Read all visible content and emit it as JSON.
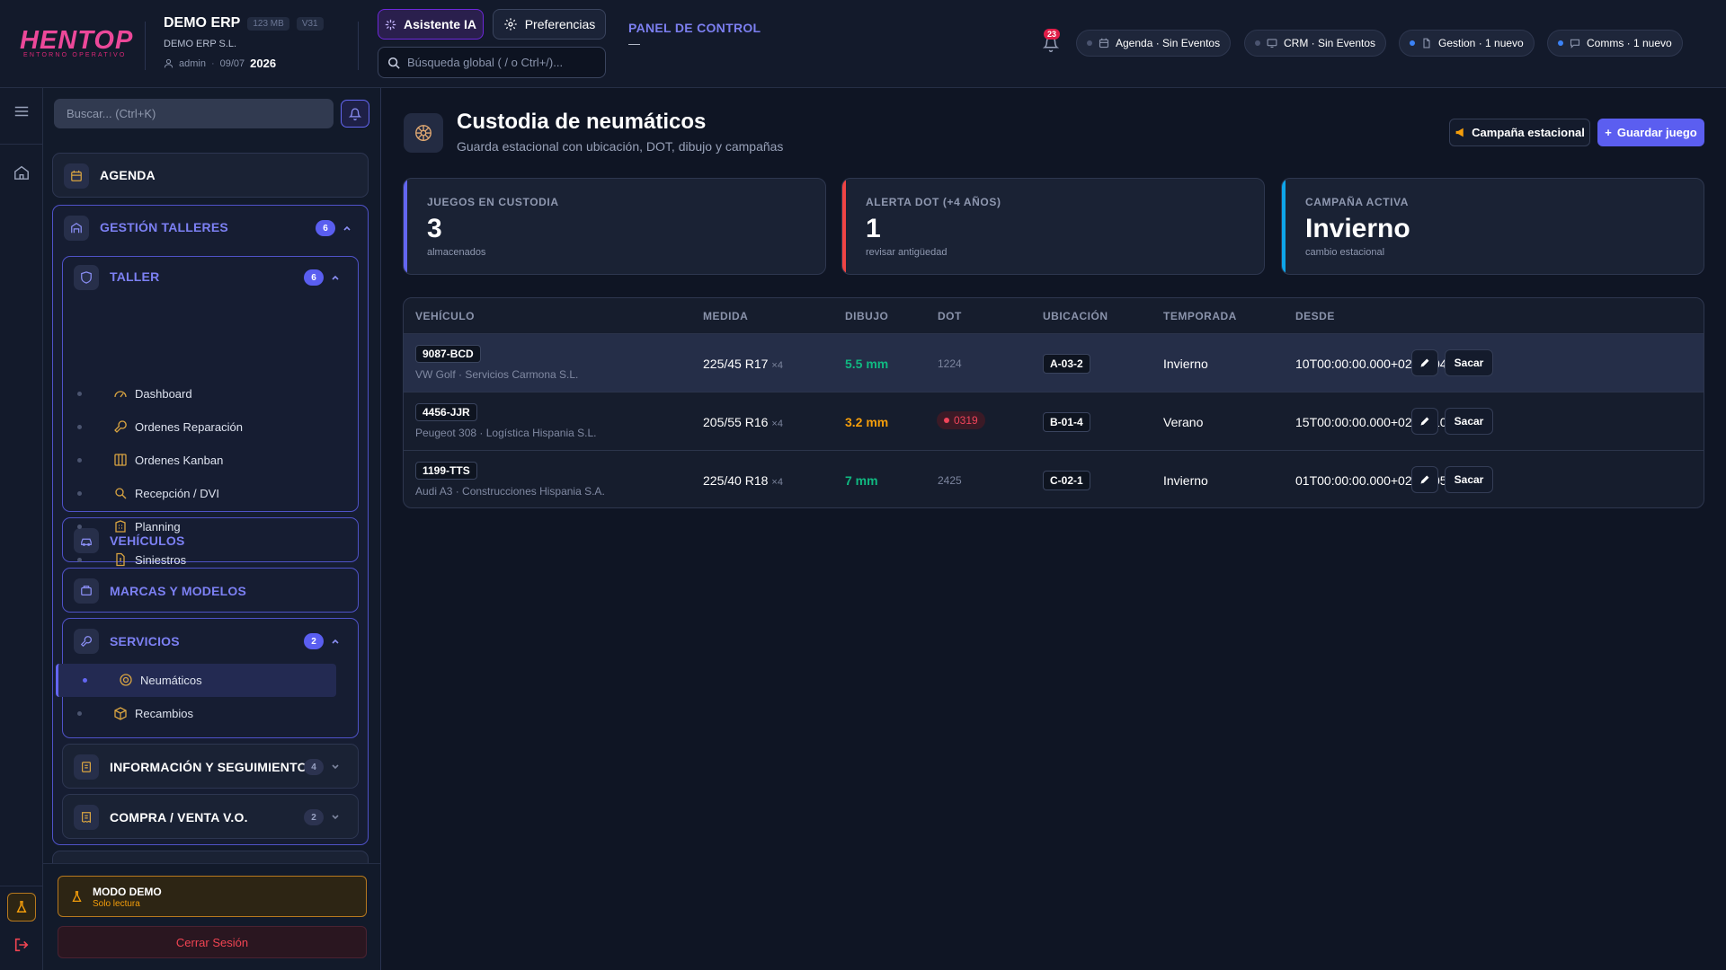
{
  "brand": {
    "logo_text": "HENTOP",
    "logo_sub": "ENTORNO OPERATIVO"
  },
  "erp": {
    "title": "DEMO ERP",
    "mem": "123 MB",
    "version": "V31",
    "company": "DEMO ERP S.L.",
    "user": "admin",
    "date": "09/07",
    "year": "2026"
  },
  "header": {
    "ai_label": "Asistente IA",
    "prefs_label": "Preferencias",
    "search_placeholder": "Búsqueda global ( / o Ctrl+/)...",
    "panel_label": "PANEL DE CONTROL",
    "panel_value": "—",
    "notif_count": "23",
    "pills": [
      {
        "label": "Agenda · Sin Eventos",
        "dot": "#4b5470"
      },
      {
        "label": "CRM · Sin Eventos",
        "dot": "#4b5470"
      },
      {
        "label": "Gestion · 1 nuevo",
        "dot": "#3b82f6"
      },
      {
        "label": "Comms · 1 nuevo",
        "dot": "#3b82f6"
      }
    ]
  },
  "sidebar": {
    "search_placeholder": "Buscar... (Ctrl+K)",
    "agenda": "AGENDA",
    "gestion": {
      "label": "GESTIÓN TALLERES",
      "count": "6"
    },
    "taller": {
      "label": "TALLER",
      "count": "6",
      "items": [
        "Dashboard",
        "Ordenes Reparación",
        "Ordenes Kanban",
        "Recepción / DVI",
        "Planning",
        "Siniestros"
      ]
    },
    "vehiculos": "VEHÍCULOS",
    "marcas": "MARCAS Y MODELOS",
    "servicios": {
      "label": "SERVICIOS",
      "count": "2",
      "items": [
        "Neumáticos",
        "Recambios"
      ]
    },
    "info": {
      "label": "INFORMACIÓN Y SEGUIMIENTO",
      "count": "4"
    },
    "compra": {
      "label": "COMPRA / VENTA V.O.",
      "count": "2"
    },
    "demo_title": "MODO DEMO",
    "demo_sub": "Solo lectura",
    "logout": "Cerrar Sesión"
  },
  "page": {
    "title": "Custodia de neumáticos",
    "subtitle": "Guarda estacional con ubicación, DOT, dibujo y campañas",
    "btn_campaign": "Campaña estacional",
    "btn_save": "Guardar juego"
  },
  "kpis": [
    {
      "label": "JUEGOS EN CUSTODIA",
      "value": "3",
      "sub": "almacenados",
      "color": "#6366f1"
    },
    {
      "label": "ALERTA DOT (+4 AÑOS)",
      "value": "1",
      "sub": "revisar antigüedad",
      "color": "#ef4444"
    },
    {
      "label": "CAMPAÑA ACTIVA",
      "value": "Invierno",
      "sub": "cambio estacional",
      "color": "#0ea5e9"
    }
  ],
  "table": {
    "headers": [
      "VEHÍCULO",
      "MEDIDA",
      "DIBUJO",
      "DOT",
      "UBICACIÓN",
      "TEMPORADA",
      "DESDE"
    ],
    "action_label": "Sacar",
    "rows": [
      {
        "plate": "9087-BCD",
        "vehicle": "VW Golf · Servicios Carmona S.L.",
        "size": "225/45 R17",
        "qty": "×4",
        "depth": "5.5 mm",
        "depth_color": "#10b981",
        "dot": "1224",
        "dot_alert": false,
        "loc": "A-03-2",
        "season": "Invierno",
        "since": "10T00:00:00.000+02:00/04/2026"
      },
      {
        "plate": "4456-JJR",
        "vehicle": "Peugeot 308 · Logística Hispania S.L.",
        "size": "205/55 R16",
        "qty": "×4",
        "depth": "3.2 mm",
        "depth_color": "#f59e0b",
        "dot": "0319",
        "dot_alert": true,
        "loc": "B-01-4",
        "season": "Verano",
        "since": "15T00:00:00.000+02:00/10/2025"
      },
      {
        "plate": "1199-TTS",
        "vehicle": "Audi A3 · Construcciones Hispania S.A.",
        "size": "225/40 R18",
        "qty": "×4",
        "depth": "7 mm",
        "depth_color": "#10b981",
        "dot": "2425",
        "dot_alert": false,
        "loc": "C-02-1",
        "season": "Invierno",
        "since": "01T00:00:00.000+02:00/05/2026"
      }
    ]
  }
}
